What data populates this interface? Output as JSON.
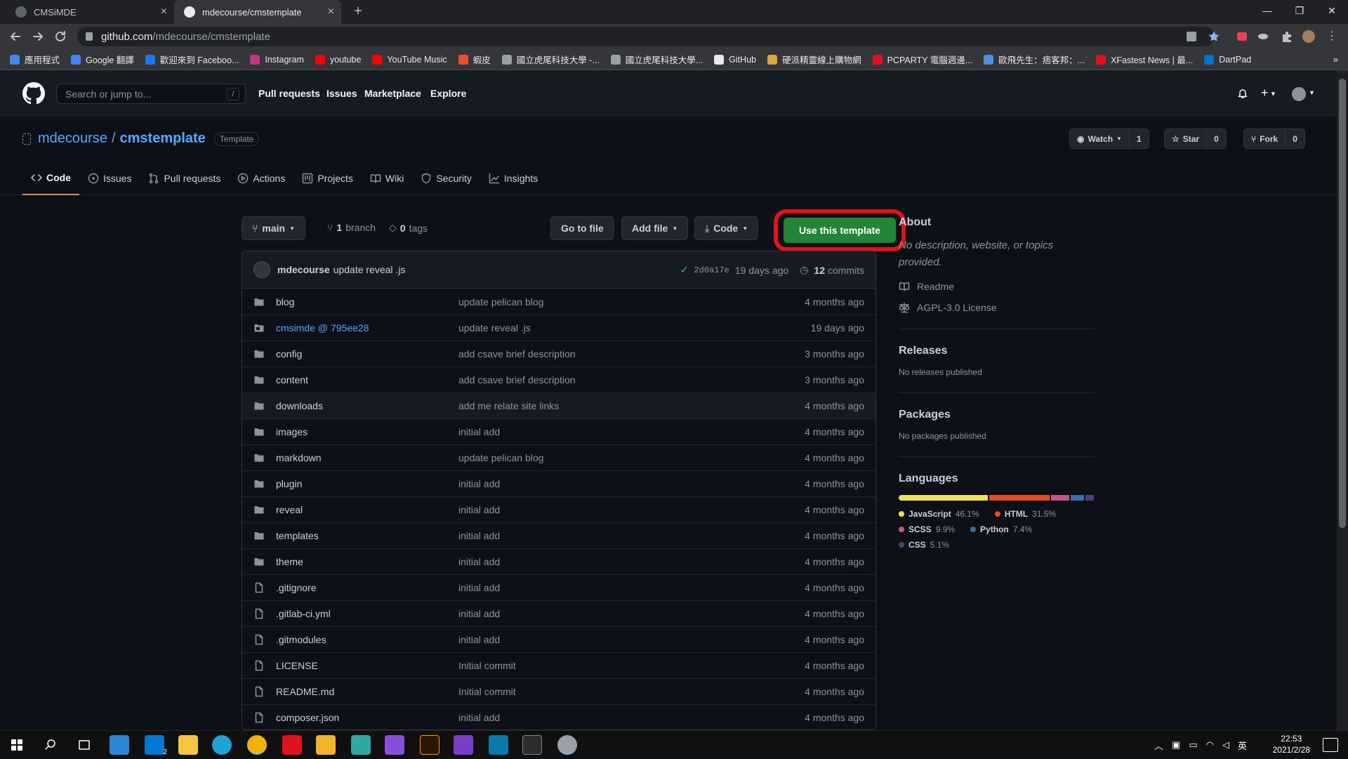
{
  "browser": {
    "tabs": [
      {
        "title": "CMSiMDE",
        "active": false
      },
      {
        "title": "mdecourse/cmstemplate",
        "active": true
      }
    ],
    "url_host": "github.com",
    "url_path": "/mdecourse/cmstemplate",
    "bookmarks": [
      {
        "label": "應用程式",
        "color": "#4285f4"
      },
      {
        "label": "Google 翻譯",
        "color": "#4285f4"
      },
      {
        "label": "歡迎來到 Faceboo...",
        "color": "#1877f2"
      },
      {
        "label": "Instagram",
        "color": "#c13584"
      },
      {
        "label": "youtube",
        "color": "#ff0000"
      },
      {
        "label": "YouTube Music",
        "color": "#ff0000"
      },
      {
        "label": "蝦皮",
        "color": "#ee4d2d"
      },
      {
        "label": "國立虎尾科技大學 -...",
        "color": "#9aa0a6"
      },
      {
        "label": "國立虎尾科技大學...",
        "color": "#9aa0a6"
      },
      {
        "label": "GitHub",
        "color": "#e8eaed"
      },
      {
        "label": "硬派精靈線上購物網",
        "color": "#d9a441"
      },
      {
        "label": "PCPARTY 電腦週邊...",
        "color": "#e0121c"
      },
      {
        "label": "歐飛先生：痞客邦：...",
        "color": "#4a90d9"
      },
      {
        "label": "XFastest News | 最...",
        "color": "#e0121c"
      },
      {
        "label": "DartPad",
        "color": "#0175c2"
      }
    ]
  },
  "header": {
    "search_placeholder": "Search or jump to...",
    "slash": "/",
    "nav": [
      "Pull requests",
      "Issues",
      "Marketplace",
      "Explore"
    ]
  },
  "repo": {
    "owner": "mdecourse",
    "sep": "/",
    "name": "cmstemplate",
    "badge": "Template",
    "watch_label": "Watch",
    "watch_count": "1",
    "star_label": "Star",
    "star_count": "0",
    "fork_label": "Fork",
    "fork_count": "0",
    "tabs": [
      "Code",
      "Issues",
      "Pull requests",
      "Actions",
      "Projects",
      "Wiki",
      "Security",
      "Insights"
    ]
  },
  "toolbar": {
    "branch": "main",
    "branches_count": "1",
    "branches_label": "branch",
    "tags_count": "0",
    "tags_label": "tags",
    "go_to_file": "Go to file",
    "add_file": "Add file",
    "code": "Code",
    "use_template": "Use this template"
  },
  "commit": {
    "author": "mdecourse",
    "message": "update reveal .js",
    "sha": "2d0a17e",
    "age": "19 days ago",
    "commits_count": "12",
    "commits_label": "commits"
  },
  "files": [
    {
      "name": "blog",
      "type": "dir",
      "msg": "update pelican blog",
      "age": "4 months ago"
    },
    {
      "name": "cmsimde @ 795ee28",
      "type": "submodule",
      "msg": "update reveal .js",
      "age": "19 days ago"
    },
    {
      "name": "config",
      "type": "dir",
      "msg": "add csave brief description",
      "age": "3 months ago"
    },
    {
      "name": "content",
      "type": "dir",
      "msg": "add csave brief description",
      "age": "3 months ago"
    },
    {
      "name": "downloads",
      "type": "dir",
      "msg": "add me relate site links",
      "age": "4 months ago"
    },
    {
      "name": "images",
      "type": "dir",
      "msg": "initial add",
      "age": "4 months ago"
    },
    {
      "name": "markdown",
      "type": "dir",
      "msg": "update pelican blog",
      "age": "4 months ago"
    },
    {
      "name": "plugin",
      "type": "dir",
      "msg": "initial add",
      "age": "4 months ago"
    },
    {
      "name": "reveal",
      "type": "dir",
      "msg": "initial add",
      "age": "4 months ago"
    },
    {
      "name": "templates",
      "type": "dir",
      "msg": "initial add",
      "age": "4 months ago"
    },
    {
      "name": "theme",
      "type": "dir",
      "msg": "initial add",
      "age": "4 months ago"
    },
    {
      "name": ".gitignore",
      "type": "file",
      "msg": "initial add",
      "age": "4 months ago"
    },
    {
      "name": ".gitlab-ci.yml",
      "type": "file",
      "msg": "initial add",
      "age": "4 months ago"
    },
    {
      "name": ".gitmodules",
      "type": "file",
      "msg": "initial add",
      "age": "4 months ago"
    },
    {
      "name": "LICENSE",
      "type": "file",
      "msg": "Initial commit",
      "age": "4 months ago"
    },
    {
      "name": "README.md",
      "type": "file",
      "msg": "Initial commit",
      "age": "4 months ago"
    },
    {
      "name": "composer.json",
      "type": "file",
      "msg": "initial add",
      "age": "4 months ago"
    }
  ],
  "about": {
    "title": "About",
    "description": "No description, website, or topics provided.",
    "readme": "Readme",
    "license": "AGPL-3.0 License"
  },
  "releases": {
    "title": "Releases",
    "text": "No releases published"
  },
  "packages": {
    "title": "Packages",
    "text": "No packages published"
  },
  "languages": {
    "title": "Languages",
    "items": [
      {
        "name": "JavaScript",
        "percent": "46.1%",
        "value": 46.1,
        "color": "#f1e05a"
      },
      {
        "name": "HTML",
        "percent": "31.5%",
        "value": 31.5,
        "color": "#e34c26"
      },
      {
        "name": "SCSS",
        "percent": "9.9%",
        "value": 9.9,
        "color": "#c6538c"
      },
      {
        "name": "Python",
        "percent": "7.4%",
        "value": 7.4,
        "color": "#3572a5"
      },
      {
        "name": "CSS",
        "percent": "5.1%",
        "value": 5.1,
        "color": "#563d7c"
      }
    ]
  },
  "taskbar": {
    "ime": "英",
    "time": "22:53",
    "date": "2021/2/28",
    "notif_count": "2"
  }
}
